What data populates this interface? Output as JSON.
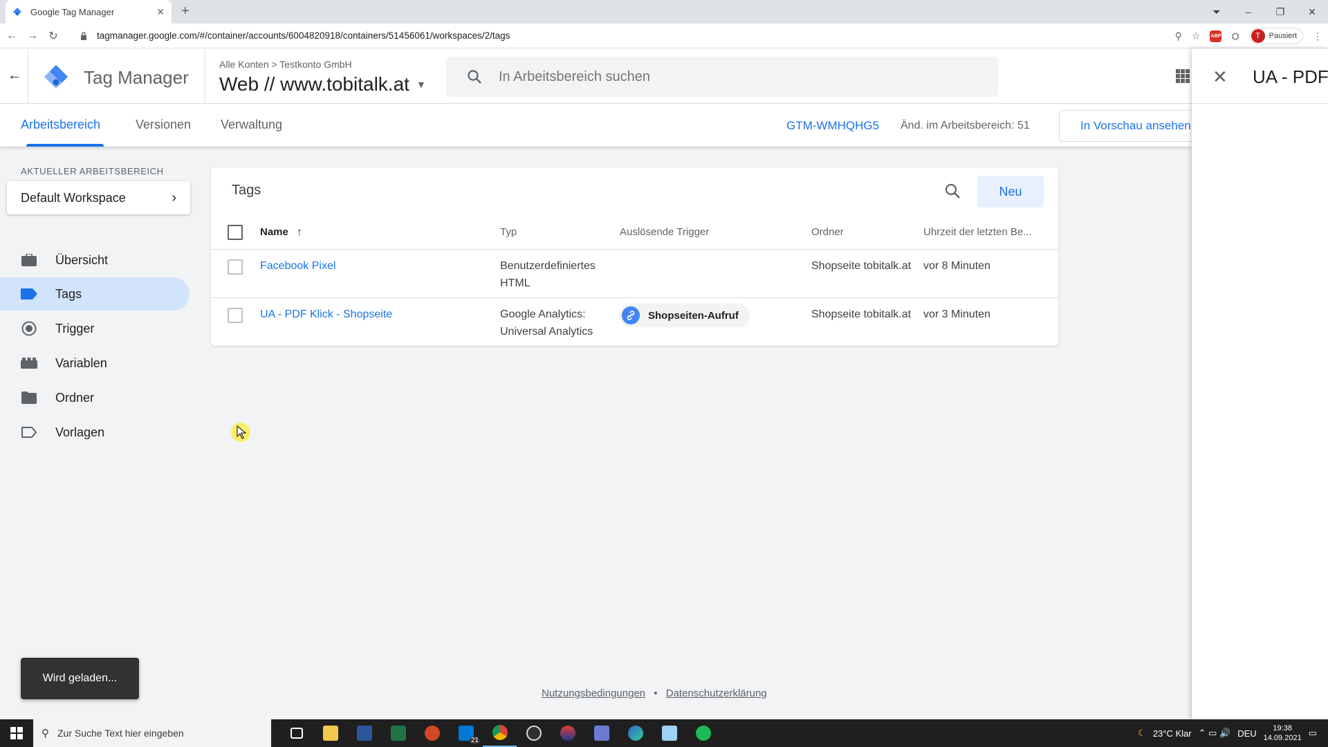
{
  "browser": {
    "tab_title": "Google Tag Manager",
    "tab_close": "✕",
    "new_tab": "+",
    "window_controls": {
      "dropdown": "⏷",
      "minimize": "–",
      "restore": "❐",
      "close": "✕"
    },
    "nav": {
      "back": "←",
      "forward": "→",
      "reload": "↻"
    },
    "url": "tagmanager.google.com/#/container/accounts/6004820918/containers/51456061/workspaces/2/tags",
    "zoom_icon": "⚲",
    "star_icon": "☆",
    "abp_label": "ABP",
    "ext_icon": "⛭",
    "profile": {
      "initial": "T",
      "status": "Pausiert"
    },
    "menu_icon": "⋮"
  },
  "header": {
    "back": "←",
    "app_title": "Tag Manager",
    "breadcrumb": "Alle Konten  >  Testkonto GmbH",
    "container": "Web // www.tobitalk.at",
    "container_caret": "▼",
    "search_placeholder": "In Arbeitsbereich suchen"
  },
  "tabs": {
    "items": [
      "Arbeitsbereich",
      "Versionen",
      "Verwaltung"
    ],
    "container_id": "GTM-WMHQHG5",
    "changes": "Änd. im Arbeitsbereich: 51",
    "preview": "In Vorschau ansehen"
  },
  "sidebar": {
    "workspace_label": "AKTUELLER ARBEITSBEREICH",
    "workspace": "Default Workspace",
    "workspace_chevron": "›",
    "items": [
      {
        "label": "Übersicht",
        "icon": "briefcase-icon"
      },
      {
        "label": "Tags",
        "icon": "tag-icon"
      },
      {
        "label": "Trigger",
        "icon": "trigger-icon"
      },
      {
        "label": "Variablen",
        "icon": "variables-icon"
      },
      {
        "label": "Ordner",
        "icon": "folder-icon"
      },
      {
        "label": "Vorlagen",
        "icon": "template-icon"
      }
    ],
    "active_index": 1
  },
  "tags_card": {
    "title": "Tags",
    "new_button": "Neu",
    "columns": {
      "name": "Name",
      "sort_arrow": "↑",
      "type": "Typ",
      "triggers": "Auslösende Trigger",
      "folder": "Ordner",
      "modified": "Uhrzeit der letzten Be..."
    },
    "rows": [
      {
        "name": "Facebook Pixel",
        "type_line1": "Benutzerdefiniertes",
        "type_line2": "HTML",
        "trigger": "",
        "folder": "Shopseite tobitalk.at",
        "modified": "vor 8 Minuten"
      },
      {
        "name": "UA - PDF Klick - Shopseite",
        "type_line1": "Google Analytics:",
        "type_line2": "Universal Analytics",
        "trigger": "Shopseiten-Aufruf",
        "folder": "Shopseite tobitalk.at",
        "modified": "vor 3 Minuten"
      }
    ]
  },
  "footer": {
    "terms": "Nutzungsbedingungen",
    "separator": "•",
    "privacy": "Datenschutzerklärung"
  },
  "snackbar": "Wird geladen...",
  "side_panel": {
    "close": "✕",
    "title": "UA - PDF"
  },
  "taskbar": {
    "search_icon": "⚲",
    "search_placeholder": "Zur Suche Text hier eingeben",
    "badge": "21",
    "weather": "23°C  Klar",
    "tray_symbols": "⌃  ▭  🔊",
    "lang": "DEU",
    "time": "19:38",
    "date": "14.09.2021",
    "notif": "▭"
  },
  "colors": {
    "accent": "#1a73e8",
    "active_nav": "#d2e3fc",
    "snackbar": "#323232"
  }
}
